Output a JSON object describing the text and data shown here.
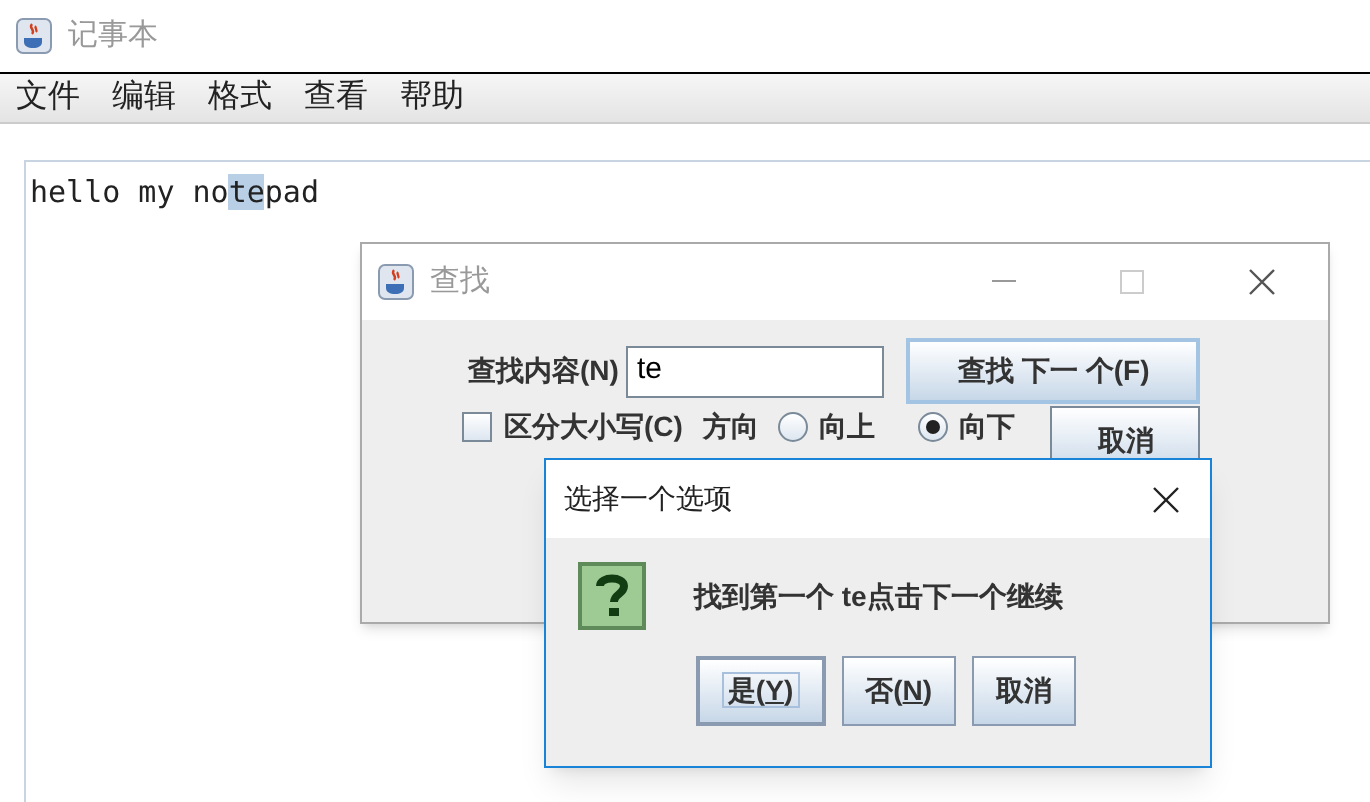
{
  "window": {
    "title": "记事本"
  },
  "menu": [
    "文件",
    "编辑",
    "格式",
    "查看",
    "帮助"
  ],
  "editor": {
    "text_before": "hello my no",
    "selected_text": "te",
    "text_after": "pad"
  },
  "find_dialog": {
    "title": "查找",
    "find_label": "查找内容(N)",
    "find_value": "te",
    "find_next_button": "查找 下一 个(F)",
    "cancel_button": "取消",
    "case_checkbox": {
      "label": "区分大小写(C)",
      "checked": false
    },
    "direction_label": "方向",
    "directions": [
      {
        "label": "向上",
        "selected": false
      },
      {
        "label": "向下",
        "selected": true
      }
    ]
  },
  "option_dialog": {
    "title": "选择一个选项",
    "message": "找到第一个 te点击下一个继续",
    "buttons": [
      {
        "before": "是(",
        "key": "Y",
        "after": ")",
        "focused": true
      },
      {
        "before": "否(",
        "key": "N",
        "after": ")",
        "focused": false
      },
      {
        "before": "取消",
        "focused": false
      }
    ]
  }
}
